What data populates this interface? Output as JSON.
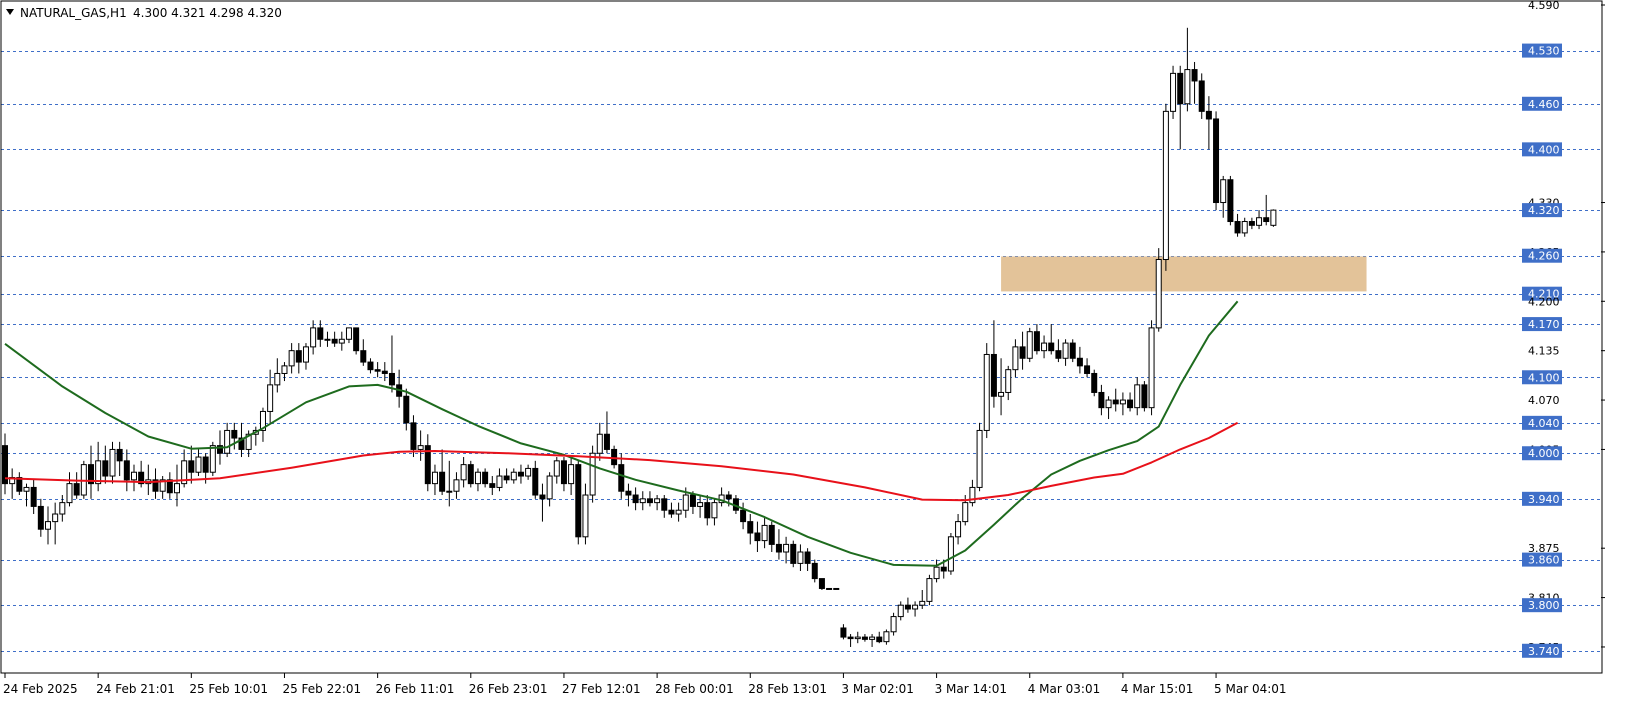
{
  "header": {
    "symbol": "NATURAL_GAS,H1",
    "ohlc": "4.300 4.321 4.298 4.320"
  },
  "colors": {
    "background": "#ffffff",
    "grid_line": "#3f6fc8",
    "label_bg": "#3f6fc8",
    "label_text": "#ffffff",
    "candle_bull_body": "#ffffff",
    "candle_bear_body": "#000000",
    "candle_outline": "#000000",
    "ma_fast": "#1e6b1e",
    "ma_slow": "#e8111a",
    "zone": "#deb887"
  },
  "chart_data": {
    "type": "candlestick",
    "instrument": "NATURAL_GAS",
    "timeframe": "H1",
    "ylim": [
      3.716,
      4.59
    ],
    "y_scale_labels": [
      "4.590",
      "4.530",
      "4.460",
      "4.400",
      "4.330",
      "4.320",
      "4.265",
      "4.260",
      "4.210",
      "4.200",
      "4.170",
      "4.135",
      "4.100",
      "4.070",
      "4.040",
      "4.005",
      "4.000",
      "3.940",
      "3.875",
      "3.860",
      "3.810",
      "3.800",
      "3.745",
      "3.740"
    ],
    "horizontal_levels": [
      "4.530",
      "4.460",
      "4.400",
      "4.320",
      "4.260",
      "4.210",
      "4.170",
      "4.100",
      "4.040",
      "4.000",
      "3.940",
      "3.860",
      "3.800",
      "3.740"
    ],
    "x_tick_labels": [
      "24 Feb 2025",
      "24 Feb 21:01",
      "25 Feb 10:01",
      "25 Feb 22:01",
      "26 Feb 11:01",
      "26 Feb 23:01",
      "27 Feb 12:01",
      "28 Feb 00:01",
      "28 Feb 13:01",
      "3 Mar 02:01",
      "3 Mar 14:01",
      "4 Mar 03:01",
      "4 Mar 15:01",
      "5 Mar 04:01"
    ],
    "x_tick_candle_index": [
      0,
      13,
      26,
      39,
      52,
      65,
      78,
      91,
      104,
      117,
      130,
      143,
      156,
      169
    ],
    "zone": {
      "low": 4.213,
      "high": 4.259,
      "from_index": 139,
      "to_index": 190
    },
    "moving_averages": [
      {
        "color": "ma_fast",
        "x": [
          0,
          8,
          14,
          20,
          26,
          31,
          36,
          42,
          48,
          52,
          56,
          61,
          66,
          72,
          78,
          83,
          88,
          94,
          100,
          106,
          112,
          118,
          124,
          130,
          134,
          138,
          142,
          146,
          150,
          154,
          158,
          161,
          164,
          168,
          172
        ],
        "values": [
          4.144,
          4.088,
          4.053,
          4.022,
          4.006,
          4.008,
          4.033,
          4.067,
          4.088,
          4.09,
          4.081,
          4.058,
          4.036,
          4.013,
          3.998,
          3.98,
          3.965,
          3.951,
          3.938,
          3.916,
          3.89,
          3.869,
          3.853,
          3.852,
          3.872,
          3.906,
          3.941,
          3.972,
          3.99,
          4.004,
          4.016,
          4.035,
          4.09,
          4.155,
          4.2
        ]
      },
      {
        "color": "ma_slow",
        "x": [
          0,
          10,
          20,
          30,
          40,
          50,
          55,
          60,
          70,
          80,
          90,
          100,
          110,
          120,
          128,
          134,
          140,
          146,
          152,
          156,
          160,
          164,
          168,
          172
        ],
        "values": [
          3.967,
          3.964,
          3.962,
          3.967,
          3.981,
          3.997,
          4.002,
          4.003,
          4.0,
          3.996,
          3.991,
          3.983,
          3.972,
          3.955,
          3.939,
          3.938,
          3.945,
          3.957,
          3.968,
          3.973,
          3.988,
          4.005,
          4.02,
          4.04
        ]
      }
    ],
    "candles": [
      [
        4.01,
        4.026,
        3.946,
        3.96
      ],
      [
        3.96,
        3.98,
        3.94,
        3.968
      ],
      [
        3.968,
        3.975,
        3.945,
        3.95
      ],
      [
        3.95,
        3.96,
        3.93,
        3.955
      ],
      [
        3.955,
        3.965,
        3.92,
        3.93
      ],
      [
        3.93,
        3.94,
        3.89,
        3.9
      ],
      [
        3.9,
        3.93,
        3.88,
        3.91
      ],
      [
        3.91,
        3.935,
        3.88,
        3.92
      ],
      [
        3.92,
        3.945,
        3.91,
        3.935
      ],
      [
        3.935,
        3.975,
        3.93,
        3.96
      ],
      [
        3.96,
        3.975,
        3.94,
        3.945
      ],
      [
        3.945,
        3.99,
        3.94,
        3.985
      ],
      [
        3.985,
        4.01,
        3.94,
        3.96
      ],
      [
        3.96,
        4.015,
        3.95,
        3.99
      ],
      [
        3.99,
        4.01,
        3.96,
        3.97
      ],
      [
        3.97,
        4.015,
        3.96,
        4.005
      ],
      [
        4.005,
        4.015,
        3.97,
        3.99
      ],
      [
        3.99,
        4.005,
        3.95,
        3.965
      ],
      [
        3.965,
        3.985,
        3.95,
        3.975
      ],
      [
        3.975,
        3.99,
        3.955,
        3.96
      ],
      [
        3.96,
        3.985,
        3.945,
        3.965
      ],
      [
        3.965,
        3.98,
        3.94,
        3.95
      ],
      [
        3.95,
        3.97,
        3.94,
        3.965
      ],
      [
        3.965,
        3.975,
        3.94,
        3.948
      ],
      [
        3.948,
        3.985,
        3.93,
        3.96
      ],
      [
        3.96,
        4.005,
        3.955,
        3.99
      ],
      [
        3.99,
        4.01,
        3.96,
        3.975
      ],
      [
        3.975,
        4.005,
        3.97,
        3.995
      ],
      [
        3.995,
        4.0,
        3.96,
        3.975
      ],
      [
        3.975,
        4.015,
        3.97,
        4.01
      ],
      [
        4.01,
        4.03,
        3.985,
        4.0
      ],
      [
        4.0,
        4.04,
        3.995,
        4.03
      ],
      [
        4.03,
        4.04,
        4.005,
        4.02
      ],
      [
        4.02,
        4.04,
        3.995,
        4.005
      ],
      [
        4.005,
        4.03,
        3.995,
        4.025
      ],
      [
        4.025,
        4.035,
        4.01,
        4.03
      ],
      [
        4.03,
        4.06,
        4.015,
        4.055
      ],
      [
        4.055,
        4.11,
        4.04,
        4.09
      ],
      [
        4.09,
        4.125,
        4.08,
        4.105
      ],
      [
        4.105,
        4.12,
        4.095,
        4.115
      ],
      [
        4.115,
        4.145,
        4.105,
        4.135
      ],
      [
        4.135,
        4.145,
        4.105,
        4.12
      ],
      [
        4.12,
        4.145,
        4.11,
        4.14
      ],
      [
        4.14,
        4.175,
        4.13,
        4.165
      ],
      [
        4.165,
        4.175,
        4.14,
        4.15
      ],
      [
        4.15,
        4.16,
        4.14,
        4.15
      ],
      [
        4.15,
        4.16,
        4.14,
        4.145
      ],
      [
        4.145,
        4.16,
        4.135,
        4.15
      ],
      [
        4.15,
        4.165,
        4.145,
        4.165
      ],
      [
        4.165,
        4.165,
        4.13,
        4.135
      ],
      [
        4.135,
        4.15,
        4.115,
        4.12
      ],
      [
        4.12,
        4.125,
        4.105,
        4.11
      ],
      [
        4.11,
        4.12,
        4.1,
        4.108
      ],
      [
        4.108,
        4.12,
        4.095,
        4.105
      ],
      [
        4.105,
        4.155,
        4.08,
        4.09
      ],
      [
        4.09,
        4.11,
        4.06,
        4.075
      ],
      [
        4.075,
        4.085,
        4.03,
        4.04
      ],
      [
        4.04,
        4.05,
        3.995,
        4.005
      ],
      [
        4.005,
        4.03,
        3.99,
        4.01
      ],
      [
        4.01,
        4.025,
        3.95,
        3.96
      ],
      [
        3.96,
        3.985,
        3.945,
        3.975
      ],
      [
        3.975,
        4.005,
        3.945,
        3.95
      ],
      [
        3.95,
        3.99,
        3.93,
        3.95
      ],
      [
        3.95,
        3.975,
        3.94,
        3.965
      ],
      [
        3.965,
        3.995,
        3.955,
        3.985
      ],
      [
        3.985,
        3.99,
        3.955,
        3.96
      ],
      [
        3.96,
        3.98,
        3.95,
        3.975
      ],
      [
        3.975,
        3.98,
        3.955,
        3.96
      ],
      [
        3.96,
        3.97,
        3.945,
        3.955
      ],
      [
        3.955,
        3.98,
        3.95,
        3.97
      ],
      [
        3.97,
        3.98,
        3.96,
        3.965
      ],
      [
        3.965,
        3.98,
        3.96,
        3.975
      ],
      [
        3.975,
        3.985,
        3.96,
        3.97
      ],
      [
        3.97,
        3.985,
        3.965,
        3.98
      ],
      [
        3.98,
        3.99,
        3.94,
        3.945
      ],
      [
        3.945,
        3.96,
        3.91,
        3.94
      ],
      [
        3.94,
        3.975,
        3.93,
        3.97
      ],
      [
        3.97,
        3.995,
        3.96,
        3.99
      ],
      [
        3.99,
        3.995,
        3.95,
        3.96
      ],
      [
        3.96,
        3.995,
        3.945,
        3.985
      ],
      [
        3.985,
        3.99,
        3.88,
        3.89
      ],
      [
        3.89,
        3.96,
        3.88,
        3.945
      ],
      [
        3.945,
        4.01,
        3.935,
        4.0
      ],
      [
        4.0,
        4.04,
        3.99,
        4.025
      ],
      [
        4.025,
        4.055,
        4.0,
        4.005
      ],
      [
        4.005,
        4.01,
        3.98,
        3.985
      ],
      [
        3.985,
        4.0,
        3.94,
        3.95
      ],
      [
        3.95,
        3.96,
        3.93,
        3.945
      ],
      [
        3.945,
        3.955,
        3.925,
        3.935
      ],
      [
        3.935,
        3.95,
        3.925,
        3.94
      ],
      [
        3.94,
        3.95,
        3.93,
        3.935
      ],
      [
        3.935,
        3.945,
        3.925,
        3.94
      ],
      [
        3.94,
        3.945,
        3.915,
        3.925
      ],
      [
        3.925,
        3.935,
        3.915,
        3.92
      ],
      [
        3.92,
        3.935,
        3.91,
        3.925
      ],
      [
        3.925,
        3.955,
        3.915,
        3.945
      ],
      [
        3.945,
        3.95,
        3.92,
        3.93
      ],
      [
        3.93,
        3.945,
        3.915,
        3.935
      ],
      [
        3.935,
        3.945,
        3.905,
        3.915
      ],
      [
        3.915,
        3.94,
        3.905,
        3.935
      ],
      [
        3.935,
        3.955,
        3.93,
        3.945
      ],
      [
        3.945,
        3.95,
        3.93,
        3.94
      ],
      [
        3.94,
        3.945,
        3.92,
        3.925
      ],
      [
        3.925,
        3.935,
        3.9,
        3.91
      ],
      [
        3.91,
        3.92,
        3.88,
        3.895
      ],
      [
        3.895,
        3.91,
        3.87,
        3.885
      ],
      [
        3.885,
        3.915,
        3.875,
        3.905
      ],
      [
        3.905,
        3.91,
        3.87,
        3.88
      ],
      [
        3.88,
        3.9,
        3.86,
        3.87
      ],
      [
        3.87,
        3.89,
        3.855,
        3.88
      ],
      [
        3.88,
        3.885,
        3.85,
        3.855
      ],
      [
        3.855,
        3.88,
        3.845,
        3.87
      ],
      [
        3.87,
        3.875,
        3.845,
        3.855
      ],
      [
        3.855,
        3.86,
        3.83,
        3.835
      ],
      [
        3.835,
        3.835,
        3.82,
        3.822
      ],
      [
        3.822,
        3.822,
        3.822,
        3.822
      ],
      [
        3.822,
        3.822,
        3.822,
        3.822
      ],
      [
        3.77,
        3.775,
        3.755,
        3.758
      ],
      [
        3.758,
        3.762,
        3.745,
        3.756
      ],
      [
        3.756,
        3.765,
        3.75,
        3.758
      ],
      [
        3.758,
        3.762,
        3.752,
        3.755
      ],
      [
        3.755,
        3.762,
        3.745,
        3.758
      ],
      [
        3.758,
        3.765,
        3.75,
        3.752
      ],
      [
        3.752,
        3.768,
        3.748,
        3.765
      ],
      [
        3.765,
        3.79,
        3.76,
        3.785
      ],
      [
        3.785,
        3.805,
        3.78,
        3.8
      ],
      [
        3.8,
        3.81,
        3.79,
        3.795
      ],
      [
        3.795,
        3.805,
        3.785,
        3.8
      ],
      [
        3.8,
        3.82,
        3.795,
        3.805
      ],
      [
        3.805,
        3.84,
        3.8,
        3.835
      ],
      [
        3.835,
        3.86,
        3.83,
        3.85
      ],
      [
        3.85,
        3.86,
        3.835,
        3.845
      ],
      [
        3.845,
        3.895,
        3.84,
        3.89
      ],
      [
        3.89,
        3.92,
        3.88,
        3.91
      ],
      [
        3.91,
        3.945,
        3.905,
        3.935
      ],
      [
        3.935,
        3.965,
        3.93,
        3.955
      ],
      [
        3.955,
        4.04,
        3.95,
        4.03
      ],
      [
        4.03,
        4.145,
        4.02,
        4.13
      ],
      [
        4.13,
        4.175,
        4.06,
        4.075
      ],
      [
        4.075,
        4.125,
        4.05,
        4.08
      ],
      [
        4.08,
        4.115,
        4.07,
        4.11
      ],
      [
        4.11,
        4.15,
        4.1,
        4.14
      ],
      [
        4.14,
        4.16,
        4.11,
        4.125
      ],
      [
        4.125,
        4.165,
        4.12,
        4.16
      ],
      [
        4.16,
        4.17,
        4.13,
        4.135
      ],
      [
        4.135,
        4.155,
        4.125,
        4.145
      ],
      [
        4.145,
        4.17,
        4.13,
        4.135
      ],
      [
        4.135,
        4.15,
        4.12,
        4.125
      ],
      [
        4.125,
        4.15,
        4.115,
        4.145
      ],
      [
        4.145,
        4.15,
        4.12,
        4.125
      ],
      [
        4.125,
        4.14,
        4.105,
        4.115
      ],
      [
        4.115,
        4.125,
        4.1,
        4.105
      ],
      [
        4.105,
        4.11,
        4.075,
        4.08
      ],
      [
        4.08,
        4.09,
        4.05,
        4.06
      ],
      [
        4.06,
        4.075,
        4.045,
        4.07
      ],
      [
        4.07,
        4.085,
        4.055,
        4.065
      ],
      [
        4.065,
        4.08,
        4.05,
        4.07
      ],
      [
        4.07,
        4.08,
        4.055,
        4.06
      ],
      [
        4.06,
        4.1,
        4.05,
        4.09
      ],
      [
        4.09,
        4.095,
        4.055,
        4.06
      ],
      [
        4.06,
        4.175,
        4.05,
        4.165
      ],
      [
        4.165,
        4.27,
        4.16,
        4.255
      ],
      [
        4.255,
        4.46,
        4.24,
        4.45
      ],
      [
        4.45,
        4.51,
        4.44,
        4.5
      ],
      [
        4.5,
        4.51,
        4.4,
        4.46
      ],
      [
        4.46,
        4.56,
        4.45,
        4.505
      ],
      [
        4.505,
        4.515,
        4.46,
        4.49
      ],
      [
        4.49,
        4.5,
        4.44,
        4.45
      ],
      [
        4.45,
        4.47,
        4.4,
        4.44
      ],
      [
        4.44,
        4.45,
        4.32,
        4.33
      ],
      [
        4.33,
        4.365,
        4.31,
        4.36
      ],
      [
        4.36,
        4.365,
        4.3,
        4.305
      ],
      [
        4.305,
        4.315,
        4.285,
        4.29
      ],
      [
        4.29,
        4.31,
        4.285,
        4.305
      ],
      [
        4.305,
        4.31,
        4.295,
        4.3
      ],
      [
        4.3,
        4.32,
        4.295,
        4.31
      ],
      [
        4.31,
        4.34,
        4.3,
        4.305
      ],
      [
        4.3,
        4.321,
        4.298,
        4.32
      ]
    ]
  }
}
